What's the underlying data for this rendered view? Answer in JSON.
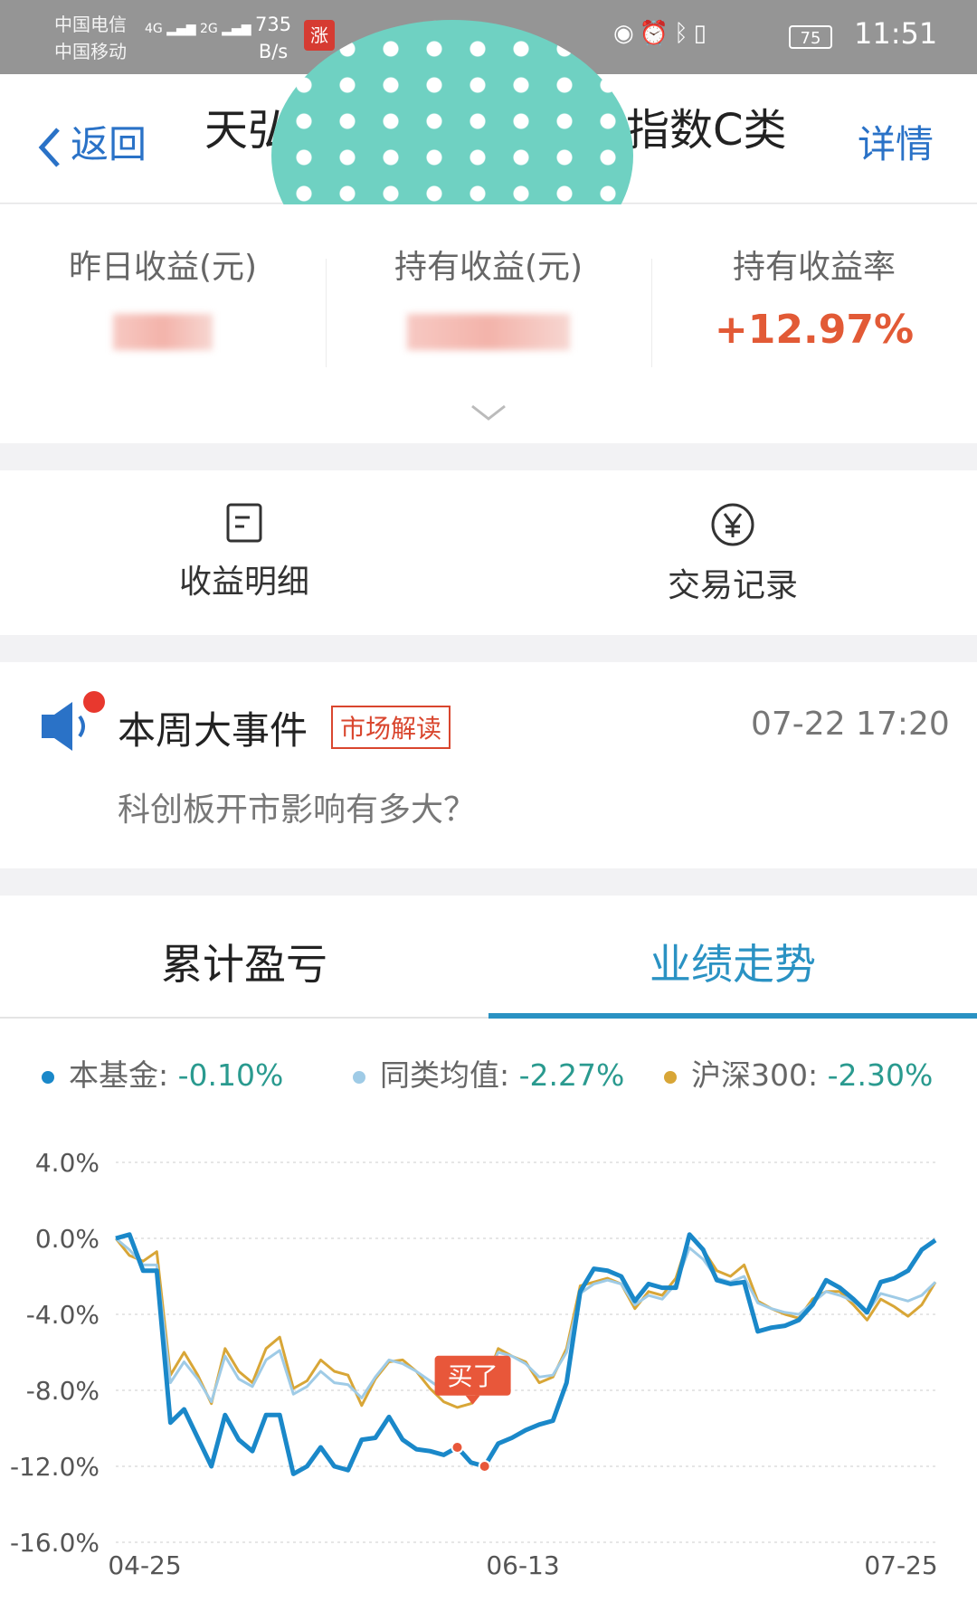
{
  "status_bar": {
    "carrier_1": "中国电信",
    "carrier_2": "中国移动",
    "net_1": "4G",
    "net_2": "2G",
    "speed_value": "735",
    "speed_unit": "B/s",
    "app_badge": "涨",
    "battery": "75",
    "time": "11:51"
  },
  "nav": {
    "back_label": "返回",
    "title_left": "天弘",
    "title_right": "指数C类",
    "detail_label": "详情"
  },
  "summary": {
    "yesterday_label": "昨日收益(元)",
    "holding_label": "持有收益(元)",
    "rate_label": "持有收益率",
    "rate_value": "+12.97%"
  },
  "actions": {
    "income_detail": "收益明细",
    "trade_record": "交易记录"
  },
  "news": {
    "title": "本周大事件",
    "tag": "市场解读",
    "time": "07-22 17:20",
    "headline": "科创板开市影响有多大？"
  },
  "tabs": {
    "cumulative": "累计盈亏",
    "trend": "业绩走势"
  },
  "legend": [
    {
      "name": "本基金",
      "value": "-0.10%",
      "color": "#1a88c9"
    },
    {
      "name": "同类均值",
      "value": "-2.27%",
      "color": "#9fcbe6"
    },
    {
      "name": "沪深300",
      "value": "-2.30%",
      "color": "#d8a637"
    }
  ],
  "chart_data": {
    "type": "line",
    "ylim": [
      -16,
      4
    ],
    "y_ticks": [
      "4.0%",
      "0.0%",
      "-4.0%",
      "-8.0%",
      "-12.0%",
      "-16.0%"
    ],
    "x_tick_labels": [
      "04-25",
      "06-13",
      "07-25"
    ],
    "annotation": "买了",
    "series": [
      {
        "name": "本基金",
        "color": "#1a88c9",
        "values": [
          0,
          0.2,
          -1.7,
          -1.7,
          -9.7,
          -9,
          -10.5,
          -12,
          -9.3,
          -10.6,
          -11.2,
          -9.3,
          -9.3,
          -12.4,
          -12.0,
          -11.0,
          -12.0,
          -12.2,
          -10.6,
          -10.5,
          -9.4,
          -10.6,
          -11.1,
          -11.2,
          -11.4,
          -11.0,
          -11.8,
          -12.0,
          -10.8,
          -10.5,
          -10.1,
          -9.8,
          -9.6,
          -7.6,
          -2.8,
          -1.6,
          -1.7,
          -2.0,
          -3.3,
          -2.4,
          -2.6,
          -2.6,
          0.2,
          -0.6,
          -2.2,
          -2.4,
          -2.3,
          -4.9,
          -4.7,
          -4.6,
          -4.3,
          -3.5,
          -2.2,
          -2.6,
          -3.2,
          -3.9,
          -2.3,
          -2.1,
          -1.7,
          -0.6,
          -0.1
        ]
      },
      {
        "name": "同类均值",
        "color": "#9fcbe6",
        "values": [
          0,
          -0.6,
          -1.4,
          -1.4,
          -7.6,
          -6.5,
          -7.4,
          -8.6,
          -6.2,
          -7.4,
          -7.8,
          -6.4,
          -5.9,
          -8.2,
          -7.8,
          -7.0,
          -7.6,
          -7.7,
          -8.4,
          -7.3,
          -6.4,
          -6.6,
          -7.0,
          -7.5,
          -8.0,
          -8.2,
          -8.1,
          -7.4,
          -6.0,
          -6.2,
          -6.6,
          -7.3,
          -7.2,
          -6.0,
          -2.9,
          -2.4,
          -2.2,
          -2.4,
          -3.5,
          -3.0,
          -3.2,
          -2.4,
          -0.5,
          -1.1,
          -2.1,
          -2.3,
          -2.0,
          -3.4,
          -3.7,
          -3.9,
          -4.0,
          -3.4,
          -2.8,
          -3.0,
          -3.3,
          -3.9,
          -2.9,
          -3.1,
          -3.3,
          -3.0,
          -2.3
        ]
      },
      {
        "name": "沪深300",
        "color": "#d8a637",
        "values": [
          0,
          -0.9,
          -1.2,
          -0.7,
          -7.2,
          -6.0,
          -7.2,
          -8.7,
          -5.8,
          -7.0,
          -7.6,
          -5.8,
          -5.2,
          -7.9,
          -7.5,
          -6.4,
          -7.0,
          -7.2,
          -8.8,
          -7.4,
          -6.5,
          -6.4,
          -7.0,
          -7.9,
          -8.6,
          -8.9,
          -8.7,
          -7.7,
          -5.8,
          -6.2,
          -6.5,
          -7.6,
          -7.3,
          -5.8,
          -2.5,
          -2.3,
          -2.1,
          -2.4,
          -3.7,
          -2.8,
          -3.0,
          -2.1,
          0.1,
          -0.6,
          -1.7,
          -2.0,
          -1.4,
          -3.3,
          -3.7,
          -4.0,
          -4.2,
          -3.2,
          -2.8,
          -2.8,
          -3.5,
          -4.3,
          -3.2,
          -3.6,
          -4.1,
          -3.5,
          -2.3
        ]
      }
    ]
  }
}
